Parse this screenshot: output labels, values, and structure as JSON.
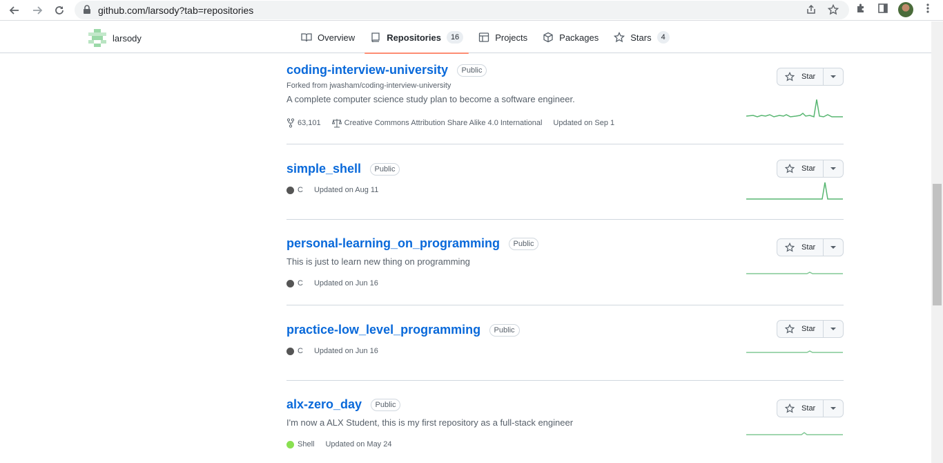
{
  "browser": {
    "url": "github.com/larsody?tab=repositories"
  },
  "profile": {
    "username": "larsody"
  },
  "tabs": [
    {
      "label": "Overview",
      "icon": "book-icon"
    },
    {
      "label": "Repositories",
      "icon": "repo-icon",
      "count": "16"
    },
    {
      "label": "Projects",
      "icon": "table-icon"
    },
    {
      "label": "Packages",
      "icon": "package-icon"
    },
    {
      "label": "Stars",
      "icon": "star-icon",
      "count": "4"
    }
  ],
  "colors": {
    "link": "#0969da",
    "selected_tab_underline": "#fd8c73",
    "lang_c": "#555555",
    "lang_shell": "#89e051",
    "sparkline": "#2da44e"
  },
  "repos": [
    {
      "name": "coding-interview-university",
      "visibility": "Public",
      "forked_from": "Forked from jwasham/coding-interview-university",
      "description": "A complete computer science study plan to become a software engineer.",
      "forks": "63,101",
      "license": "Creative Commons Attribution Share Alike 4.0 International",
      "updated": "Updated on Sep 1",
      "star_label": "Star"
    },
    {
      "name": "simple_shell",
      "visibility": "Public",
      "language": "C",
      "updated": "Updated on Aug 11",
      "star_label": "Star"
    },
    {
      "name": "personal-learning_on_programming",
      "visibility": "Public",
      "description": "This is just to learn new thing on programming",
      "language": "C",
      "updated": "Updated on Jun 16",
      "star_label": "Star"
    },
    {
      "name": "practice-low_level_programming",
      "visibility": "Public",
      "language": "C",
      "updated": "Updated on Jun 16",
      "star_label": "Star"
    },
    {
      "name": "alx-zero_day",
      "visibility": "Public",
      "description": "I'm now a ALX Student, this is my first repository as a full-stack engineer",
      "language": "Shell",
      "updated": "Updated on May 24",
      "star_label": "Star"
    }
  ]
}
